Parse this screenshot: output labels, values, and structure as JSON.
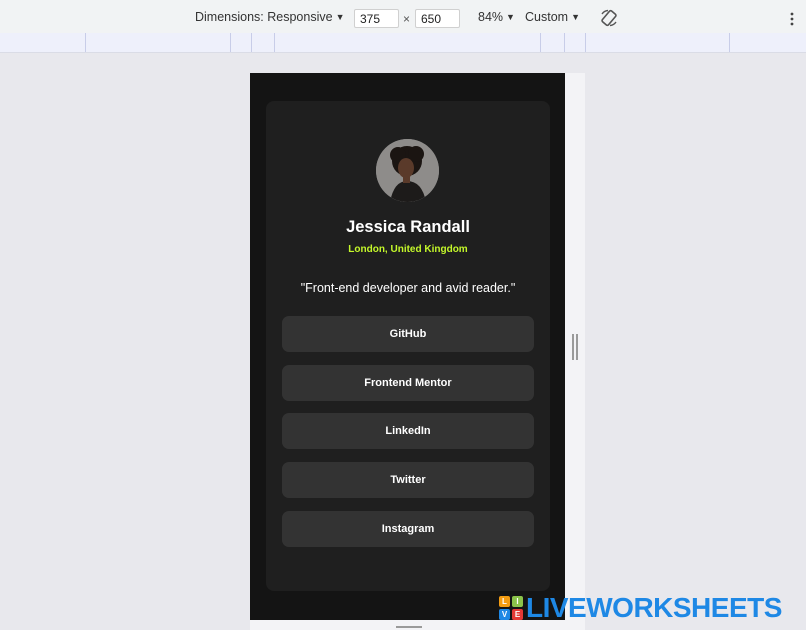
{
  "devtools": {
    "dimensions_label": "Dimensions: Responsive",
    "width_value": "375",
    "height_value": "650",
    "times_sign": "×",
    "zoom_label": "84%",
    "throttle_label": "Custom"
  },
  "profile": {
    "name": "Jessica Randall",
    "location": "London, United Kingdom",
    "bio": "\"Front-end developer and avid reader.\"",
    "links": [
      "GitHub",
      "Frontend Mentor",
      "LinkedIn",
      "Twitter",
      "Instagram"
    ],
    "accent_color": "#c4f82a",
    "card_color": "#1f1f1f",
    "button_color": "#333333"
  },
  "watermark": {
    "logo_letters": [
      "L",
      "I",
      "V",
      "E"
    ],
    "text": "LIVEWORKSHEETS"
  }
}
